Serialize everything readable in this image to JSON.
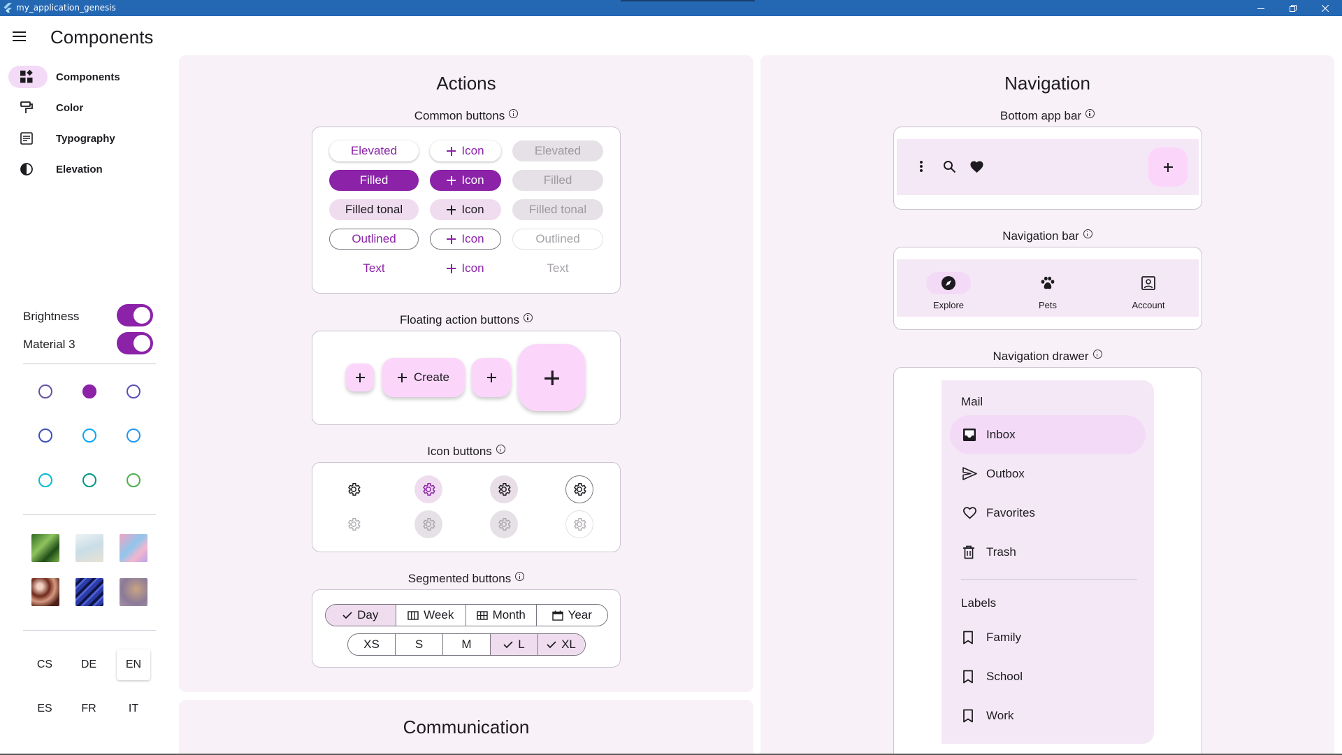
{
  "window": {
    "title": "my_application_genesis"
  },
  "app": {
    "page_title": "Components"
  },
  "rail": {
    "items": [
      {
        "label": "Components",
        "icon": "widgets-icon"
      },
      {
        "label": "Color",
        "icon": "format-paint-icon"
      },
      {
        "label": "Typography",
        "icon": "article-icon"
      },
      {
        "label": "Elevation",
        "icon": "contrast-icon"
      }
    ]
  },
  "settings": {
    "brightness_label": "Brightness",
    "material3_label": "Material 3",
    "brightness_on": true,
    "material3_on": true
  },
  "seed_colors": [
    "#6750a4",
    "#8b22a8",
    "#3f51b5",
    "#3f51b5",
    "#03a9f4",
    "#2196f3",
    "#00bcd4",
    "#009688",
    "#4caf50"
  ],
  "languages": [
    "CS",
    "DE",
    "EN",
    "ES",
    "FR",
    "IT"
  ],
  "selected_language": "EN",
  "actions": {
    "title": "Actions",
    "common_buttons": {
      "title": "Common buttons",
      "rows": [
        [
          "Elevated",
          "Icon",
          "Elevated"
        ],
        [
          "Filled",
          "Icon",
          "Filled"
        ],
        [
          "Filled tonal",
          "Icon",
          "Filled tonal"
        ],
        [
          "Outlined",
          "Icon",
          "Outlined"
        ],
        [
          "Text",
          "Icon",
          "Text"
        ]
      ]
    },
    "fab": {
      "title": "Floating action buttons",
      "extended_label": "Create"
    },
    "icon_buttons": {
      "title": "Icon buttons"
    },
    "segmented": {
      "title": "Segmented buttons",
      "row1": [
        "Day",
        "Week",
        "Month",
        "Year"
      ],
      "row2": [
        "XS",
        "S",
        "M",
        "L",
        "XL"
      ]
    }
  },
  "communication": {
    "title": "Communication"
  },
  "navigation": {
    "title": "Navigation",
    "bottom_app_bar": {
      "title": "Bottom app bar"
    },
    "navigation_bar": {
      "title": "Navigation bar",
      "destinations": [
        "Explore",
        "Pets",
        "Account"
      ]
    },
    "navigation_drawer": {
      "title": "Navigation drawer",
      "mail_header": "Mail",
      "mail_items": [
        "Inbox",
        "Outbox",
        "Favorites",
        "Trash"
      ],
      "labels_header": "Labels",
      "label_items": [
        "Family",
        "School",
        "Work"
      ]
    }
  }
}
